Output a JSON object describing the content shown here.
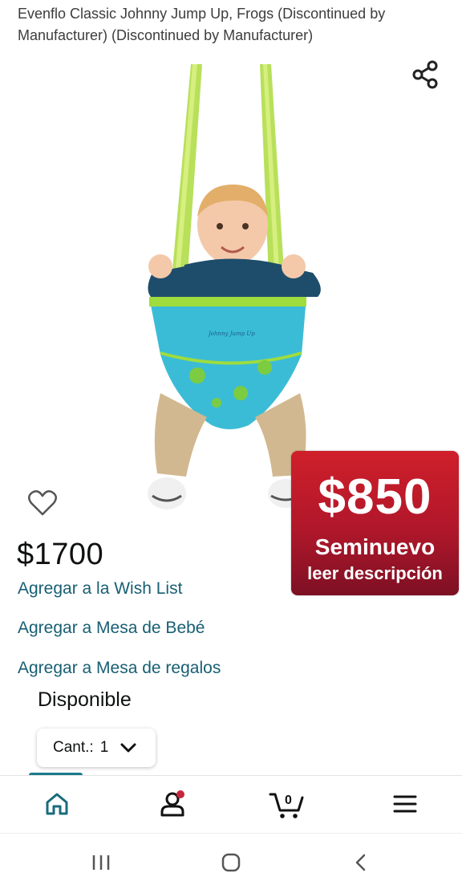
{
  "product": {
    "title": "Evenflo Classic Johnny Jump Up, Frogs (Discontinued by Manufacturer) (Discontinued by Manufacturer)",
    "price": "$1700",
    "image_label": "Johnny Jump Up"
  },
  "promo": {
    "price": "$850",
    "condition": "Seminuevo",
    "note": "leer descripción",
    "color": "#c21d2c"
  },
  "actions": {
    "wishlist": "Agregar a la Wish List",
    "baby_registry": "Agregar a Mesa de Bebé",
    "gift_registry": "Agregar a Mesa de regalos"
  },
  "availability": "Disponible",
  "quantity": {
    "label": "Cant.:",
    "value": "1"
  },
  "bottom_nav": {
    "items": [
      {
        "icon": "home-icon",
        "active": true
      },
      {
        "icon": "account-icon",
        "has_badge": true
      },
      {
        "icon": "cart-icon",
        "count": "0"
      },
      {
        "icon": "menu-icon"
      }
    ],
    "active_color": "#1a7a8c"
  },
  "system_nav": [
    "recent-apps-icon",
    "home-circle-icon",
    "back-icon"
  ]
}
